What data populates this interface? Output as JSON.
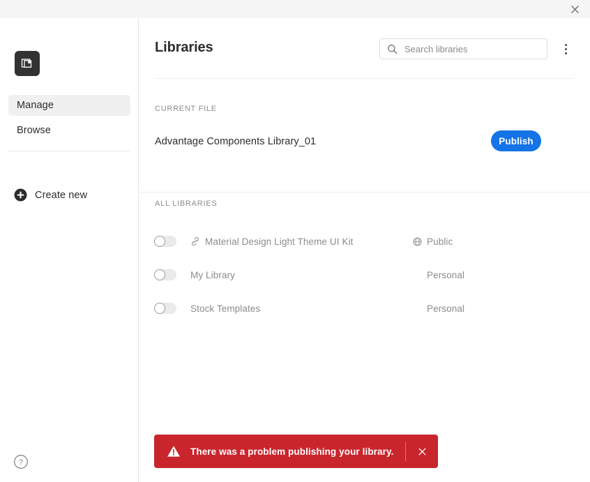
{
  "window": {
    "close_label": "×"
  },
  "sidebar": {
    "logo_icon": "libraries-app-icon",
    "nav": [
      {
        "label": "Manage",
        "active": true
      },
      {
        "label": "Browse",
        "active": false
      }
    ],
    "create_new": {
      "label": "Create new",
      "icon": "plus-circle-icon"
    },
    "help": {
      "icon": "help-circle-icon"
    }
  },
  "main": {
    "title": "Libraries",
    "search": {
      "placeholder": "Search libraries",
      "value": "",
      "icon": "search-icon"
    },
    "more_menu": {
      "icon": "more-vertical-icon"
    },
    "current_file": {
      "section_label": "CURRENT FILE",
      "name": "Advantage Components Library_01",
      "publish_label": "Publish"
    },
    "all_libraries": {
      "section_label": "ALL LIBRARIES",
      "rows": [
        {
          "name": "Material Design Light Theme UI Kit",
          "access": "Public",
          "access_icon": "globe-icon",
          "name_icon": "link-icon",
          "toggle_on": false
        },
        {
          "name": "My Library",
          "access": "Personal",
          "access_icon": "",
          "name_icon": "",
          "toggle_on": false
        },
        {
          "name": "Stock Templates",
          "access": "Personal",
          "access_icon": "",
          "name_icon": "",
          "toggle_on": false
        }
      ]
    }
  },
  "toast": {
    "message": "There was a problem publishing your library.",
    "icon": "warning-triangle-icon",
    "close_label": "×",
    "color": "#c9252d"
  },
  "colors": {
    "accent": "#1473e6",
    "error": "#c9252d",
    "titlebar": "#f5f5f5",
    "logo": "#323232"
  }
}
